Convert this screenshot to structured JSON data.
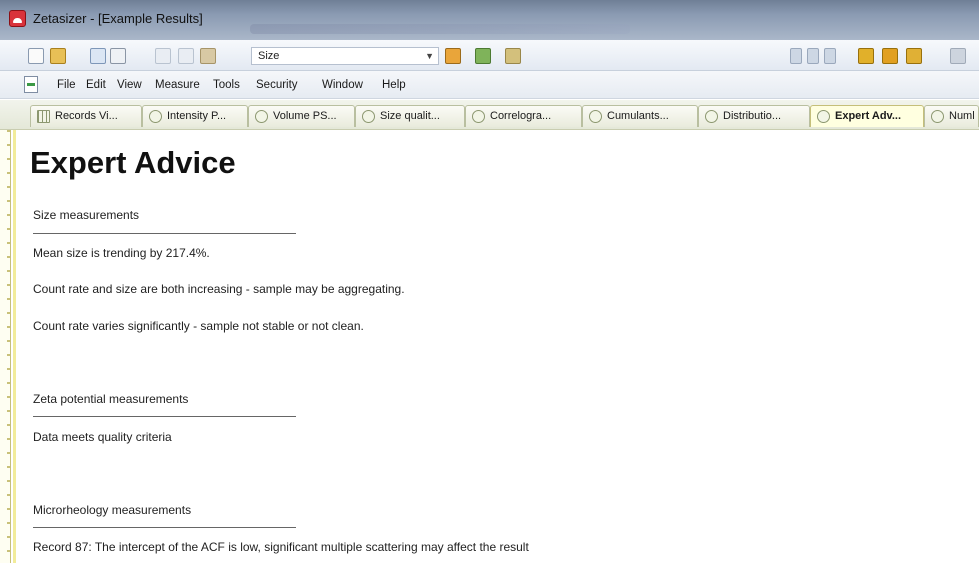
{
  "window": {
    "title": "Zetasizer - [Example Results]"
  },
  "toolbar": {
    "size_combo_value": "Size"
  },
  "menu": {
    "items": [
      "File",
      "Edit",
      "View",
      "Measure",
      "Tools",
      "Security",
      "Window",
      "Help"
    ]
  },
  "tabs": [
    {
      "label": "Records Vi...",
      "icon": "grid-icon",
      "active": false
    },
    {
      "label": "Intensity P...",
      "icon": "report-icon",
      "active": false
    },
    {
      "label": "Volume PS...",
      "icon": "report-icon",
      "active": false
    },
    {
      "label": "Size qualit...",
      "icon": "report-icon",
      "active": false
    },
    {
      "label": "Correlogra...",
      "icon": "report-icon",
      "active": false
    },
    {
      "label": "Cumulants...",
      "icon": "report-icon",
      "active": false
    },
    {
      "label": "Distributio...",
      "icon": "report-icon",
      "active": false
    },
    {
      "label": "Expert Adv...",
      "icon": "advice-icon",
      "active": true
    },
    {
      "label": "Numl",
      "icon": "report-icon",
      "active": false
    }
  ],
  "page": {
    "title": "Expert Advice",
    "sections": [
      {
        "heading": "Size measurements",
        "lines": [
          "Mean size is trending by 217.4%.",
          "Count rate and size are both increasing - sample may be aggregating.",
          "Count rate varies significantly - sample not stable or not clean."
        ]
      },
      {
        "heading": "Zeta potential measurements",
        "lines": [
          "Data meets quality criteria"
        ]
      },
      {
        "heading": "Microrheology measurements",
        "lines": [
          "Record 87: The intercept of the ACF is low, significant multiple scattering may affect the result"
        ]
      }
    ]
  }
}
